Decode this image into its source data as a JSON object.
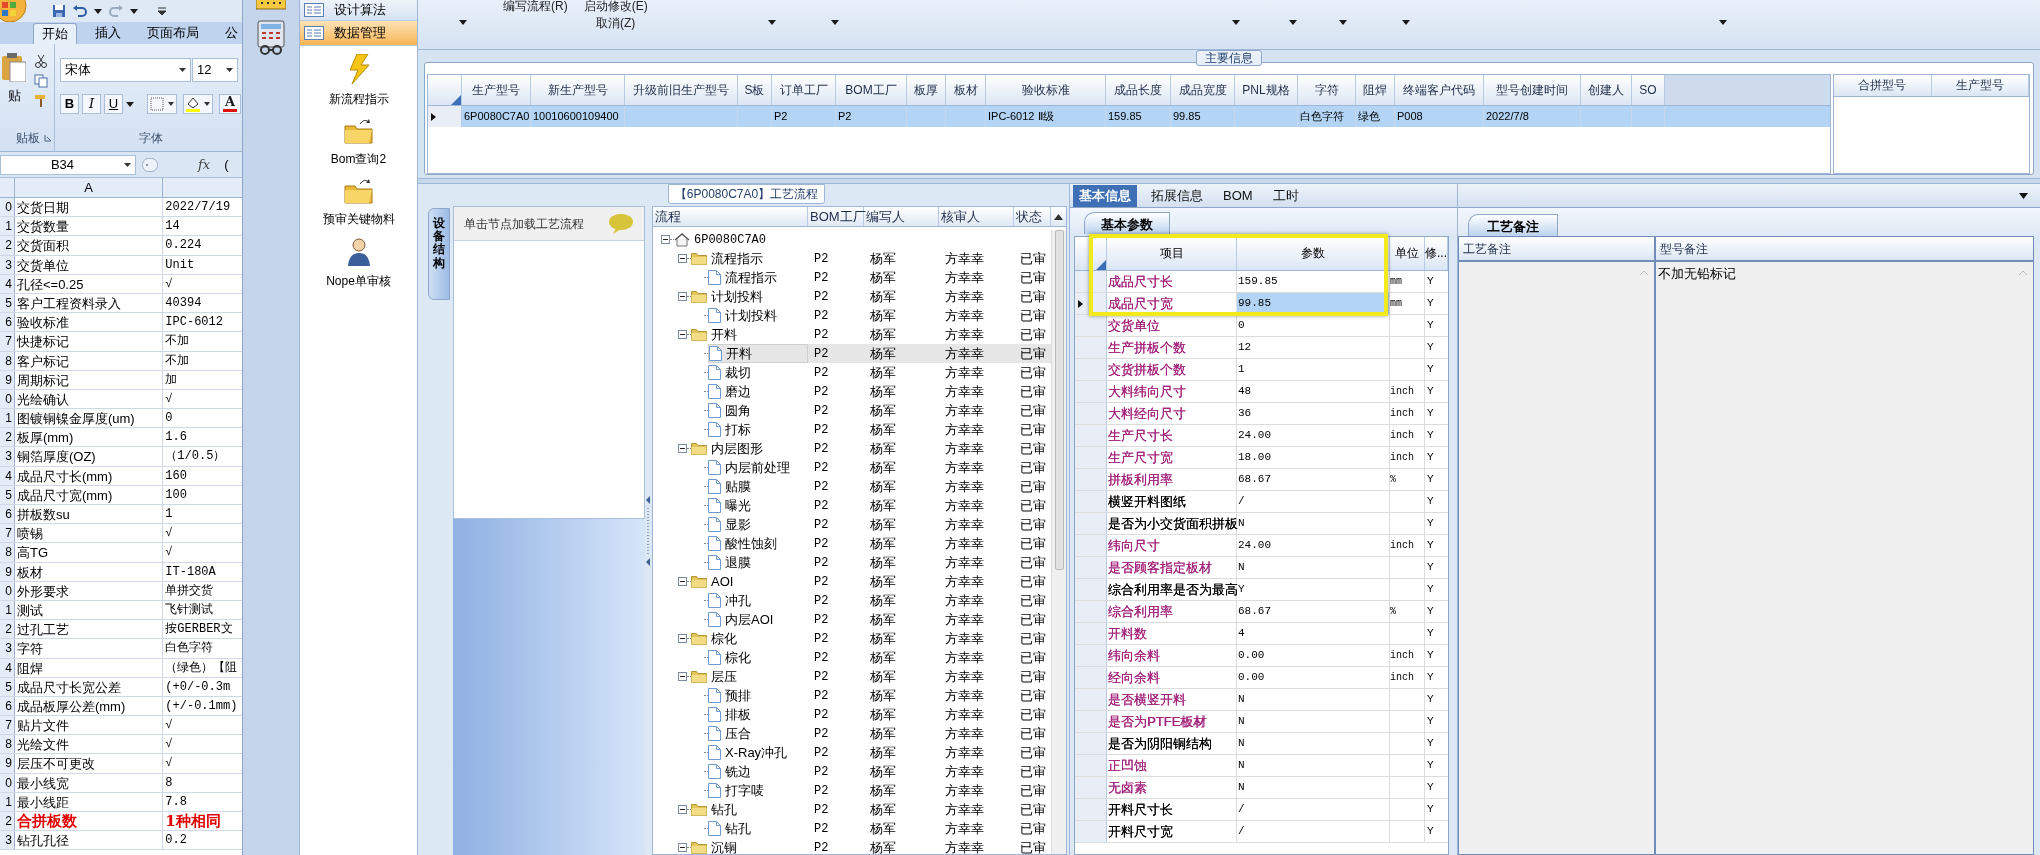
{
  "excel": {
    "tabs": [
      {
        "label": "开始",
        "selected": true
      },
      {
        "label": "插入",
        "selected": false
      },
      {
        "label": "页面布局",
        "selected": false
      },
      {
        "label": "公",
        "selected": false
      }
    ],
    "clipboard_group": {
      "paste_label": "贴",
      "group_label": "贴板"
    },
    "font_group": {
      "font_name": "宋体",
      "font_size": "12",
      "format_buttons": [
        "B",
        "I",
        "U"
      ],
      "font_color_button": "A",
      "group_label": "字体"
    },
    "name_box": "B34",
    "function_label": "fx",
    "formula": "(",
    "column_header": "A",
    "rows": [
      {
        "number": "0",
        "a": "交货日期",
        "b": "2022/7/19",
        "emphasis": false
      },
      {
        "number": "1",
        "a": "交货数量",
        "b": "14",
        "emphasis": false
      },
      {
        "number": "2",
        "a": "交货面积",
        "b": "0.224",
        "emphasis": false
      },
      {
        "number": "3",
        "a": "交货单位",
        "b": "Unit",
        "emphasis": false
      },
      {
        "number": "4",
        "a": "孔径<=0.25",
        "b": "√",
        "emphasis": false
      },
      {
        "number": "5",
        "a": "客户工程资料录入",
        "b": "40394",
        "emphasis": false
      },
      {
        "number": "6",
        "a": "验收标准",
        "b": "IPC-6012",
        "emphasis": false
      },
      {
        "number": "7",
        "a": "快捷标记",
        "b": "不加",
        "emphasis": false
      },
      {
        "number": "8",
        "a": "客户标记",
        "b": "不加",
        "emphasis": false
      },
      {
        "number": "9",
        "a": "周期标记",
        "b": "加",
        "emphasis": false
      },
      {
        "number": "0",
        "a": "光绘确认",
        "b": "√",
        "emphasis": false
      },
      {
        "number": "1",
        "a": "图镀铜镍金厚度(um)",
        "b": "0",
        "emphasis": false
      },
      {
        "number": "2",
        "a": "板厚(mm)",
        "b": "1.6",
        "emphasis": false
      },
      {
        "number": "3",
        "a": "铜箔厚度(OZ)",
        "b": "（1/0.5）",
        "emphasis": false
      },
      {
        "number": "4",
        "a": "成品尺寸长(mm)",
        "b": "160",
        "emphasis": false
      },
      {
        "number": "5",
        "a": "成品尺寸宽(mm)",
        "b": "100",
        "emphasis": false
      },
      {
        "number": "6",
        "a": "拼板数su",
        "b": "1",
        "emphasis": false
      },
      {
        "number": "7",
        "a": "喷锡",
        "b": "√",
        "emphasis": false
      },
      {
        "number": "8",
        "a": "高TG",
        "b": "√",
        "emphasis": false
      },
      {
        "number": "9",
        "a": "板材",
        "b": "IT-180A",
        "emphasis": false
      },
      {
        "number": "0",
        "a": "外形要求",
        "b": "单拼交货",
        "emphasis": false
      },
      {
        "number": "1",
        "a": "测试",
        "b": "飞针测试",
        "emphasis": false
      },
      {
        "number": "2",
        "a": "过孔工艺",
        "b": "按GERBER文",
        "emphasis": false
      },
      {
        "number": "3",
        "a": "字符",
        "b": "白色字符",
        "emphasis": false
      },
      {
        "number": "4",
        "a": "阻焊",
        "b": "（绿色）【阻",
        "emphasis": false
      },
      {
        "number": "5",
        "a": "成品尺寸长宽公差",
        "b": "(+0/-0.3m",
        "emphasis": false
      },
      {
        "number": "6",
        "a": "成品板厚公差(mm)",
        "b": "(+/-0.1mm)",
        "emphasis": false
      },
      {
        "number": "7",
        "a": "贴片文件",
        "b": "√",
        "emphasis": false
      },
      {
        "number": "8",
        "a": "光绘文件",
        "b": "√",
        "emphasis": false
      },
      {
        "number": "9",
        "a": "层压不可更改",
        "b": "√",
        "emphasis": false
      },
      {
        "number": "0",
        "a": "最小线宽",
        "b": "8",
        "emphasis": false
      },
      {
        "number": "1",
        "a": "最小线距",
        "b": "7.8",
        "emphasis": false
      },
      {
        "number": "2",
        "a": "合拼板数",
        "b": "1种相同",
        "emphasis": true
      },
      {
        "number": "3",
        "a": "钻孔孔径",
        "b": "0.2",
        "emphasis": false
      }
    ]
  },
  "app_toolbar": {
    "menu_items": [
      {
        "label": "编写流程(R)"
      },
      {
        "label": "启动修改(E)"
      },
      {
        "label": "取消(Z)"
      }
    ]
  },
  "nav": {
    "items": [
      {
        "label": "设计算法",
        "selected": false
      },
      {
        "label": "数据管理",
        "selected": true
      }
    ],
    "launchers": [
      {
        "label": "新流程指示",
        "kind": "lightning"
      },
      {
        "label": "Bom查询2",
        "kind": "folder"
      },
      {
        "label": "预审关键物料",
        "kind": "folder"
      },
      {
        "label": "Nope单审核",
        "kind": "person"
      }
    ]
  },
  "main_info": {
    "title": "主要信息",
    "row_selected": true,
    "columns": [
      {
        "label": "生产型号",
        "value": "6P0080C7A0"
      },
      {
        "label": "新生产型号",
        "value": "10010600109400"
      },
      {
        "label": "升级前旧生产型号"
      },
      {
        "label": "S板"
      },
      {
        "label": "订单工厂",
        "value": "P2"
      },
      {
        "label": "BOM工厂",
        "value": "P2"
      },
      {
        "label": "板厚"
      },
      {
        "label": "板材"
      },
      {
        "label": "验收标准",
        "value": "IPC-6012 Ⅱ级"
      },
      {
        "label": "成品长度",
        "value": "159.85"
      },
      {
        "label": "成品宽度",
        "value": "99.85"
      },
      {
        "label": "PNL规格"
      },
      {
        "label": "字符",
        "value": "白色字符"
      },
      {
        "label": "阻焊",
        "value": "绿色"
      },
      {
        "label": "终端客户代码",
        "value": "P008"
      },
      {
        "label": "型号创建时间",
        "value": "2022/7/8"
      },
      {
        "label": "创建人"
      },
      {
        "label": "SO"
      }
    ],
    "merge_columns": [
      "合拼型号",
      "生产型号"
    ]
  },
  "process_flow": {
    "title": "【6P0080C7A0】工艺流程",
    "side_tab": "设备结构",
    "hint": "单击节点加载工艺流程",
    "columns": [
      "流程",
      "BOM工厂",
      "编写人",
      "核审人",
      "状态"
    ],
    "tree": {
      "label": "6P0080C7A0",
      "kind": "root",
      "expanded": true,
      "selected": false,
      "children": [
        {
          "label": "流程指示",
          "kind": "folder",
          "expanded": true,
          "selected": false,
          "factory": "P2",
          "writer": "杨军",
          "reviewer": "方幸幸",
          "status": "已审",
          "children": [
            {
              "label": "流程指示",
              "kind": "step",
              "selected": false,
              "factory": "P2",
              "writer": "杨军",
              "reviewer": "方幸幸",
              "status": "已审"
            }
          ]
        },
        {
          "label": "计划投料",
          "kind": "folder",
          "expanded": true,
          "selected": false,
          "factory": "P2",
          "writer": "杨军",
          "reviewer": "方幸幸",
          "status": "已审",
          "children": [
            {
              "label": "计划投料",
              "kind": "step",
              "selected": false,
              "factory": "P2",
              "writer": "杨军",
              "reviewer": "方幸幸",
              "status": "已审"
            }
          ]
        },
        {
          "label": "开料",
          "kind": "folder",
          "expanded": true,
          "selected": false,
          "factory": "P2",
          "writer": "杨军",
          "reviewer": "方幸幸",
          "status": "已审",
          "children": [
            {
              "label": "开料",
              "kind": "step",
              "selected": true,
              "factory": "P2",
              "writer": "杨军",
              "reviewer": "方幸幸",
              "status": "已审"
            },
            {
              "label": "裁切",
              "kind": "step",
              "selected": false,
              "factory": "P2",
              "writer": "杨军",
              "reviewer": "方幸幸",
              "status": "已审"
            },
            {
              "label": "磨边",
              "kind": "step",
              "selected": false,
              "factory": "P2",
              "writer": "杨军",
              "reviewer": "方幸幸",
              "status": "已审"
            },
            {
              "label": "圆角",
              "kind": "step",
              "selected": false,
              "factory": "P2",
              "writer": "杨军",
              "reviewer": "方幸幸",
              "status": "已审"
            },
            {
              "label": "打标",
              "kind": "step",
              "selected": false,
              "factory": "P2",
              "writer": "杨军",
              "reviewer": "方幸幸",
              "status": "已审"
            }
          ]
        },
        {
          "label": "内层图形",
          "kind": "folder",
          "expanded": true,
          "selected": false,
          "factory": "P2",
          "writer": "杨军",
          "reviewer": "方幸幸",
          "status": "已审",
          "children": [
            {
              "label": "内层前处理",
              "kind": "step",
              "selected": false,
              "factory": "P2",
              "writer": "杨军",
              "reviewer": "方幸幸",
              "status": "已审"
            },
            {
              "label": "贴膜",
              "kind": "step",
              "selected": false,
              "factory": "P2",
              "writer": "杨军",
              "reviewer": "方幸幸",
              "status": "已审"
            },
            {
              "label": "曝光",
              "kind": "step",
              "selected": false,
              "factory": "P2",
              "writer": "杨军",
              "reviewer": "方幸幸",
              "status": "已审"
            },
            {
              "label": "显影",
              "kind": "step",
              "selected": false,
              "factory": "P2",
              "writer": "杨军",
              "reviewer": "方幸幸",
              "status": "已审"
            },
            {
              "label": "酸性蚀刻",
              "kind": "step",
              "selected": false,
              "factory": "P2",
              "writer": "杨军",
              "reviewer": "方幸幸",
              "status": "已审"
            },
            {
              "label": "退膜",
              "kind": "step",
              "selected": false,
              "factory": "P2",
              "writer": "杨军",
              "reviewer": "方幸幸",
              "status": "已审"
            }
          ]
        },
        {
          "label": "AOI",
          "kind": "folder",
          "expanded": true,
          "selected": false,
          "factory": "P2",
          "writer": "杨军",
          "reviewer": "方幸幸",
          "status": "已审",
          "children": [
            {
              "label": "冲孔",
              "kind": "step",
              "selected": false,
              "factory": "P2",
              "writer": "杨军",
              "reviewer": "方幸幸",
              "status": "已审"
            },
            {
              "label": "内层AOI",
              "kind": "step",
              "selected": false,
              "factory": "P2",
              "writer": "杨军",
              "reviewer": "方幸幸",
              "status": "已审"
            }
          ]
        },
        {
          "label": "棕化",
          "kind": "folder",
          "expanded": true,
          "selected": false,
          "factory": "P2",
          "writer": "杨军",
          "reviewer": "方幸幸",
          "status": "已审",
          "children": [
            {
              "label": "棕化",
              "kind": "step",
              "selected": false,
              "factory": "P2",
              "writer": "杨军",
              "reviewer": "方幸幸",
              "status": "已审"
            }
          ]
        },
        {
          "label": "层压",
          "kind": "folder",
          "expanded": true,
          "selected": false,
          "factory": "P2",
          "writer": "杨军",
          "reviewer": "方幸幸",
          "status": "已审",
          "children": [
            {
              "label": "预排",
              "kind": "step",
              "selected": false,
              "factory": "P2",
              "writer": "杨军",
              "reviewer": "方幸幸",
              "status": "已审"
            },
            {
              "label": "排板",
              "kind": "step",
              "selected": false,
              "factory": "P2",
              "writer": "杨军",
              "reviewer": "方幸幸",
              "status": "已审"
            },
            {
              "label": "压合",
              "kind": "step",
              "selected": false,
              "factory": "P2",
              "writer": "杨军",
              "reviewer": "方幸幸",
              "status": "已审"
            },
            {
              "label": "X-Ray冲孔",
              "kind": "step",
              "selected": false,
              "factory": "P2",
              "writer": "杨军",
              "reviewer": "方幸幸",
              "status": "已审"
            },
            {
              "label": "铣边",
              "kind": "step",
              "selected": false,
              "factory": "P2",
              "writer": "杨军",
              "reviewer": "方幸幸",
              "status": "已审"
            },
            {
              "label": "打字唛",
              "kind": "step",
              "selected": false,
              "factory": "P2",
              "writer": "杨军",
              "reviewer": "方幸幸",
              "status": "已审"
            }
          ]
        },
        {
          "label": "钻孔",
          "kind": "folder",
          "expanded": true,
          "selected": false,
          "factory": "P2",
          "writer": "杨军",
          "reviewer": "方幸幸",
          "status": "已审",
          "children": [
            {
              "label": "钻孔",
              "kind": "step",
              "selected": false,
              "factory": "P2",
              "writer": "杨军",
              "reviewer": "方幸幸",
              "status": "已审"
            }
          ]
        },
        {
          "label": "沉铜",
          "kind": "folder",
          "expanded": true,
          "selected": false,
          "factory": "P2",
          "writer": "杨军",
          "reviewer": "方幸幸",
          "status": "已审"
        }
      ]
    }
  },
  "detail": {
    "tabs": [
      {
        "label": "基本信息",
        "selected": true
      },
      {
        "label": "拓展信息",
        "selected": false
      },
      {
        "label": "BOM",
        "selected": false
      },
      {
        "label": "工时",
        "selected": false
      }
    ],
    "sub_tab": "基本参数",
    "columns": [
      "项目",
      "参数",
      "单位",
      "修..."
    ],
    "rows": [
      {
        "item": "成品尺寸长",
        "value": "159.85",
        "unit": "mm",
        "editable": "Y",
        "color": "#a3237c",
        "selected": false
      },
      {
        "item": "成品尺寸宽",
        "value": "99.85",
        "unit": "mm",
        "editable": "Y",
        "color": "#a3237c",
        "selected": true
      },
      {
        "item": "交货单位",
        "value": "0",
        "editable": "Y",
        "color": "#a3237c",
        "selected": false
      },
      {
        "item": "生产拼板个数",
        "value": "12",
        "editable": "Y",
        "color": "#a3237c",
        "selected": false
      },
      {
        "item": "交货拼板个数",
        "value": "1",
        "editable": "Y",
        "color": "#a3237c",
        "selected": false
      },
      {
        "item": "大料纬向尺寸",
        "value": "48",
        "unit": "inch",
        "editable": "Y",
        "color": "#a3237c",
        "selected": false
      },
      {
        "item": "大料经向尺寸",
        "value": "36",
        "unit": "inch",
        "editable": "Y",
        "color": "#a3237c",
        "selected": false
      },
      {
        "item": "生产尺寸长",
        "value": "24.00",
        "unit": "inch",
        "editable": "Y",
        "color": "#a3237c",
        "selected": false
      },
      {
        "item": "生产尺寸宽",
        "value": "18.00",
        "unit": "inch",
        "editable": "Y",
        "color": "#a3237c",
        "selected": false
      },
      {
        "item": "拼板利用率",
        "value": "68.67",
        "unit": "%",
        "editable": "Y",
        "color": "#a3237c",
        "selected": false
      },
      {
        "item": "横竖开料图纸",
        "value": "/",
        "editable": "Y",
        "color": "#000000",
        "selected": false
      },
      {
        "item": "是否为小交货面积拼板",
        "value": "N",
        "editable": "Y",
        "color": "#000000",
        "selected": false
      },
      {
        "item": "纬向尺寸",
        "value": "24.00",
        "unit": "inch",
        "editable": "Y",
        "color": "#a3237c",
        "selected": false
      },
      {
        "item": "是否顾客指定板材",
        "value": "N",
        "editable": "Y",
        "color": "#a3237c",
        "selected": false
      },
      {
        "item": "综合利用率是否为最高",
        "value": "Y",
        "editable": "Y",
        "color": "#000000",
        "selected": false
      },
      {
        "item": "综合利用率",
        "value": "68.67",
        "unit": "%",
        "editable": "Y",
        "color": "#a3237c",
        "selected": false
      },
      {
        "item": "开料数",
        "value": "4",
        "editable": "Y",
        "color": "#a3237c",
        "selected": false
      },
      {
        "item": "纬向余料",
        "value": "0.00",
        "unit": "inch",
        "editable": "Y",
        "color": "#a3237c",
        "selected": false
      },
      {
        "item": "经向余料",
        "value": "0.00",
        "unit": "inch",
        "editable": "Y",
        "color": "#a3237c",
        "selected": false
      },
      {
        "item": "是否横竖开料",
        "value": "N",
        "editable": "Y",
        "color": "#a3237c",
        "selected": false
      },
      {
        "item": "是否为PTFE板材",
        "value": "N",
        "editable": "Y",
        "color": "#a3237c",
        "selected": false
      },
      {
        "item": "是否为阴阳铜结构",
        "value": "N",
        "editable": "Y",
        "color": "#000000",
        "selected": false
      },
      {
        "item": "正凹蚀",
        "value": "N",
        "editable": "Y",
        "color": "#a3237c",
        "selected": false
      },
      {
        "item": "无卤素",
        "value": "N",
        "editable": "Y",
        "color": "#a3237c",
        "selected": false
      },
      {
        "item": "开料尺寸长",
        "value": "/",
        "editable": "Y",
        "color": "#000000",
        "selected": false
      },
      {
        "item": "开料尺寸宽",
        "value": "/",
        "editable": "Y",
        "color": "#000000",
        "selected": false
      }
    ]
  },
  "notes": {
    "tab": "工艺备注",
    "columns": [
      "工艺备注",
      "型号备注"
    ],
    "model_note": "不加无铅标记"
  }
}
